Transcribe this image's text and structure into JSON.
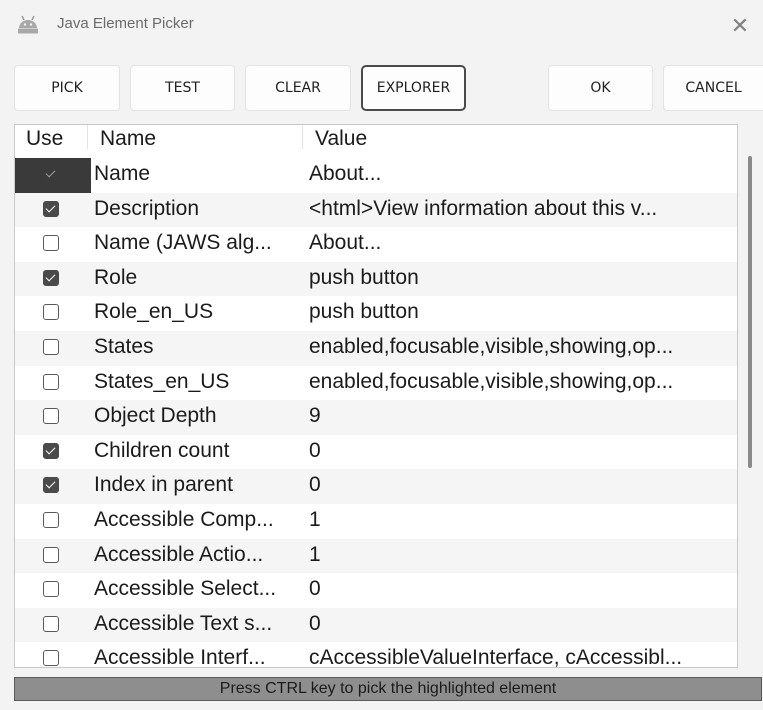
{
  "window": {
    "title": "Java Element Picker",
    "icon": "android-robot-icon"
  },
  "toolbar": {
    "pick_label": "PICK",
    "test_label": "TEST",
    "clear_label": "CLEAR",
    "explorer_label": "EXPLORER",
    "ok_label": "OK",
    "cancel_label": "CANCEL"
  },
  "table": {
    "headers": {
      "use": "Use",
      "name": "Name",
      "value": "Value"
    },
    "rows": [
      {
        "use": true,
        "name": "Name",
        "value": "About..."
      },
      {
        "use": true,
        "name": "Description",
        "value": "<html>View information about this v..."
      },
      {
        "use": false,
        "name": "Name (JAWS alg...",
        "value": "About..."
      },
      {
        "use": true,
        "name": "Role",
        "value": "push button"
      },
      {
        "use": false,
        "name": "Role_en_US",
        "value": "push button"
      },
      {
        "use": false,
        "name": "States",
        "value": "enabled,focusable,visible,showing,op..."
      },
      {
        "use": false,
        "name": "States_en_US",
        "value": "enabled,focusable,visible,showing,op..."
      },
      {
        "use": false,
        "name": "Object Depth",
        "value": "9"
      },
      {
        "use": true,
        "name": "Children count",
        "value": "0"
      },
      {
        "use": true,
        "name": "Index in parent",
        "value": "0"
      },
      {
        "use": false,
        "name": "Accessible Comp...",
        "value": "1"
      },
      {
        "use": false,
        "name": "Accessible Actio...",
        "value": "1"
      },
      {
        "use": false,
        "name": "Accessible Select...",
        "value": "0"
      },
      {
        "use": false,
        "name": "Accessible Text s...",
        "value": "0"
      },
      {
        "use": false,
        "name": "Accessible Interf...",
        "value": "cAccessibleValueInterface, cAccessibl..."
      }
    ]
  },
  "status": {
    "text": "Press CTRL key to pick the highlighted element"
  },
  "colors": {
    "background": "#f3f3f3",
    "status_bar": "#8e8e8e",
    "highlight_cell": "#3a3a3a",
    "checkbox_on": "#4a4a4a"
  }
}
